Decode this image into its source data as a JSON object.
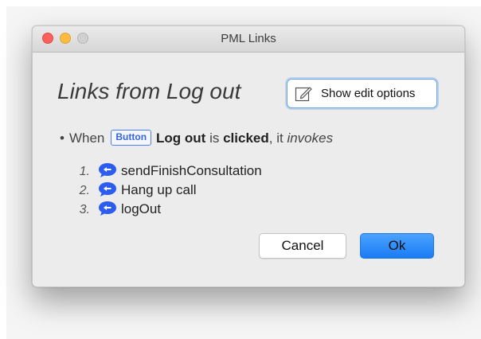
{
  "window": {
    "title": "PML Links"
  },
  "dialog": {
    "heading": "Links from Log out",
    "edit_toggle_label": "Show edit options",
    "sentence": {
      "bullet": "•",
      "when": "When",
      "element_type": "Button",
      "element_name": "Log out",
      "is": "is",
      "event": "clicked",
      "comma_it": ", it",
      "verb": "invokes"
    },
    "actions": [
      {
        "number": "1.",
        "label": "sendFinishConsultation",
        "icon": "action-bubble-icon"
      },
      {
        "number": "2.",
        "label": "Hang up call",
        "icon": "action-bubble-icon"
      },
      {
        "number": "3.",
        "label": "logOut",
        "icon": "action-bubble-icon"
      }
    ],
    "buttons": {
      "cancel": "Cancel",
      "ok": "Ok"
    }
  },
  "colors": {
    "accent": "#1a7cf5",
    "badge_blue": "#3566e0",
    "close": "#fc605c",
    "minimize": "#fdbc40",
    "zoom_disabled": "#d0d0d0"
  }
}
